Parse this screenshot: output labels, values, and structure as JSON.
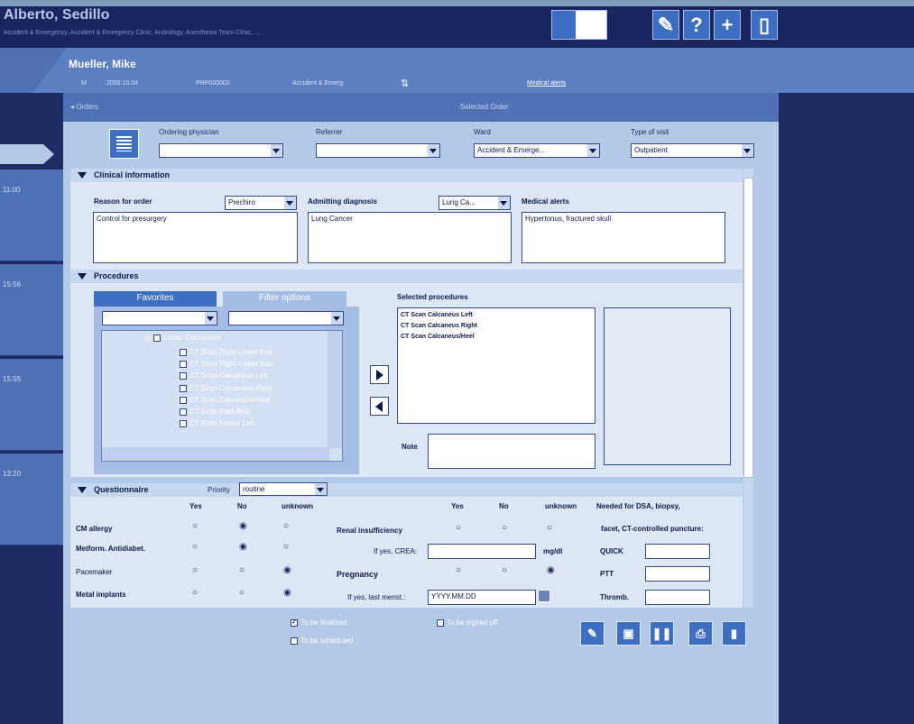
{
  "user": {
    "name": "Alberto, Sedillo",
    "departments": "Accident & Emergency, Accident & Emergency Clinic, Andrology, Anesthesia Team Clinic, ..."
  },
  "patient": {
    "name": "Mueller, Mike",
    "sex": "M",
    "dob": "2000.10.04",
    "id": "PRP000002",
    "dept": "Accident & Emerg.",
    "medical_alerts_link": "Medical alerts"
  },
  "left_times": [
    "11:00",
    "15:56",
    "15:55",
    "13:20"
  ],
  "orders": {
    "title": "Orders",
    "selected_order": "Selected Order"
  },
  "header": {
    "ordering_physician_label": "Ordering physician",
    "ordering_physician_value": "",
    "referrer_label": "Referrer",
    "referrer_value": "",
    "ward_label": "Ward",
    "ward_value": "Accident & Emerge...",
    "visit_label": "Type of visit",
    "visit_value": "Outpatient"
  },
  "clinical": {
    "title": "Clinical information",
    "reason_label": "Reason for order",
    "reason_select": "Prechiro",
    "reason_text": "Control for presurgery",
    "admit_label": "Admitting diagnosis",
    "admit_select": "Lung Ca...",
    "admit_text": "Lung Cancer",
    "alerts_label": "Medical alerts",
    "alerts_text": "Hypertonus, fractured skull"
  },
  "procedures": {
    "title": "Procedures",
    "tab_favorites": "Favorites",
    "tab_filter": "Filter options",
    "tree_parent": "Lower Extremities",
    "tree_items": [
      "CT Scan Right Lower Extr.",
      "CT Scan Right Lower Extr.",
      "CT Scan Calcaneus Left",
      "CT Scan Calcaneus Right",
      "CT Scan Calcaneus/Heel",
      "CT Scan Foot Both",
      "CT Scan Femur Left"
    ],
    "selected_label": "Selected procedures",
    "selected": [
      "CT Scan Calcaneus Left",
      "CT Scan Calcaneus Right",
      "CT Scan Calcaneus/Heel"
    ],
    "note_label": "Note"
  },
  "questionnaire": {
    "title": "Questionnaire",
    "priority_label": "Priority",
    "priority_value": "routine",
    "col_yes": "Yes",
    "col_no": "No",
    "col_unknown": "unknown",
    "right_note_1": "Needed for DSA, biopsy,",
    "right_note_2": "facet, CT-controlled puncture:",
    "rows_left": [
      "CM allergy",
      "Metform. Antidiabet.",
      "Pacemaker",
      "Metal implants"
    ],
    "renal_label": "Renal insufficiency",
    "crea_label": "If yes, CREA:",
    "crea_unit": "mg/dl",
    "pregnancy_label": "Pregnancy",
    "lastmens_label": "If yes, last menst.:",
    "lastmens_value": "YYYY.MM.DD",
    "quick_label": "QUICK",
    "ptt_label": "PTT",
    "thromb_label": "Thromb."
  },
  "footer": {
    "finalized": "To be finalized",
    "signed_off": "To be signed off",
    "scheduled": "To be scheduled"
  },
  "colors": {
    "accent": "#3d6ec2",
    "background": "#1f2b62"
  }
}
